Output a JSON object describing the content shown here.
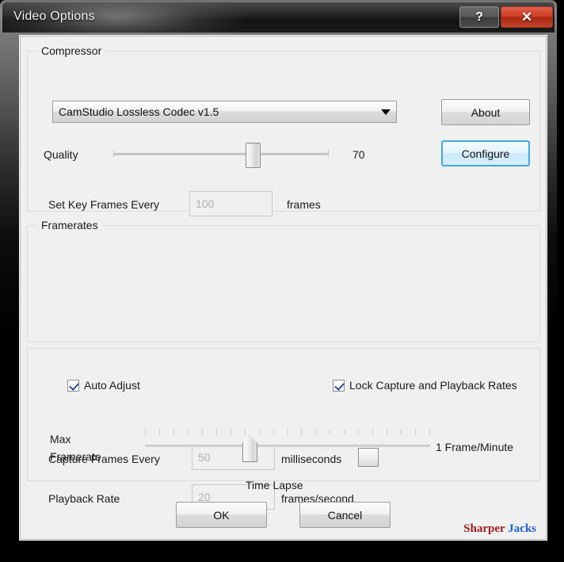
{
  "window": {
    "title": "Video Options",
    "help_label": "?",
    "close_label": "✕"
  },
  "compressor": {
    "group_label": "Compressor",
    "codec_selected": "CamStudio Lossless Codec v1.5",
    "codec_options": [
      "CamStudio Lossless Codec v1.5"
    ],
    "about_label": "About",
    "configure_label": "Configure",
    "quality_label": "Quality",
    "quality_value": "70",
    "quality_percent": 66,
    "keyframe_label": "Set Key Frames Every",
    "keyframe_value": "100",
    "keyframe_unit": "frames"
  },
  "framerates": {
    "group_label": "Framerates",
    "capture_label": "Capture Frames Every",
    "capture_value": "50",
    "capture_unit": "milliseconds",
    "playback_label": "Playback Rate",
    "playback_value": "20",
    "playback_unit": "frames/second"
  },
  "timelapse": {
    "auto_adjust_label": "Auto Adjust",
    "auto_adjust_checked": true,
    "lock_rates_label": "Lock Capture and Playback Rates",
    "lock_rates_checked": true,
    "max_framerate_line1": "Max",
    "max_framerate_line2": "Framerate",
    "max_framerate_value": "1 Frame/Minute",
    "slider_percent": 36,
    "tick_count": 21,
    "caption": "Time Lapse"
  },
  "footer": {
    "ok_label": "OK",
    "cancel_label": "Cancel",
    "watermark_first": "Sharper",
    "watermark_second": "Jacks"
  },
  "colors": {
    "accent_focus": "#3ea9e0",
    "close_red": "#cf3b25",
    "check_blue": "#2b4f9c",
    "dialog_bg": "#f0f0f0",
    "watermark_red": "#9e1b1b",
    "watermark_blue": "#1f5fd0"
  }
}
